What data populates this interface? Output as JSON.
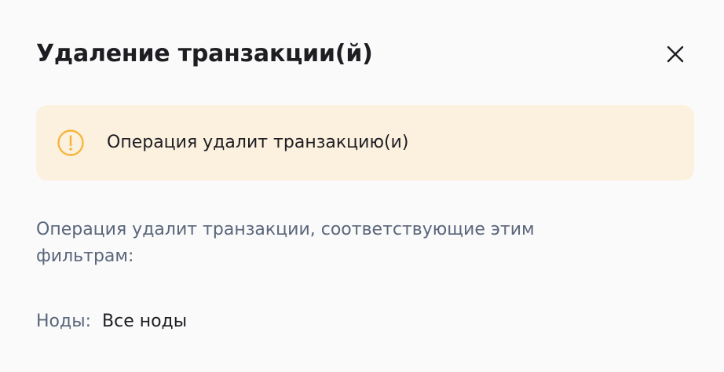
{
  "dialog": {
    "title": "Удаление транзакции(й)",
    "close_icon": "close-icon"
  },
  "warning": {
    "icon": "warning-circle-icon",
    "text": "Операция удалит транзакцию(и)",
    "background_color": "#fcf1df",
    "icon_color": "#f5b63c"
  },
  "description": "Операция удалит транзакции, соответствующие этим фильтрам:",
  "filters": {
    "nodes_label": "Ноды:",
    "nodes_value": "Все ноды"
  }
}
